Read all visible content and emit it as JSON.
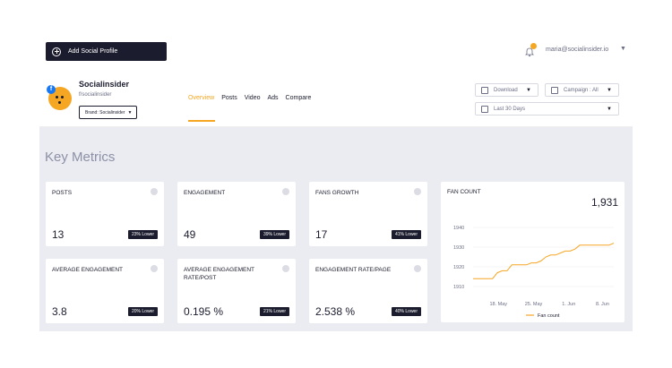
{
  "topbar": {
    "add_profile_label": "Add Social Profile",
    "user_email": "maria@socialinsider.io",
    "user_caret": "▼"
  },
  "profile": {
    "name": "Socialinsider",
    "handle": "f/socialinsider",
    "brand_select": "Brand: Socialinsider",
    "brand_caret": "▼"
  },
  "tabs": [
    "Overview",
    "Posts",
    "Video",
    "Ads",
    "Compare"
  ],
  "controls": {
    "download": "Download",
    "campaign": "Campaign : All",
    "period": "Last 30 Days",
    "caret": "▼"
  },
  "section_title": "Key Metrics",
  "metrics": [
    {
      "label": "POSTS",
      "value": "13",
      "badge": "23% Lower"
    },
    {
      "label": "ENGAGEMENT",
      "value": "49",
      "badge": "39% Lower"
    },
    {
      "label": "FANS GROWTH",
      "value": "17",
      "badge": "41% Lower"
    },
    {
      "label": "AVERAGE ENGAGEMENT",
      "value": "3.8",
      "badge": "20% Lower"
    },
    {
      "label": "AVERAGE ENGAGEMENT RATE/POST",
      "value": "0.195 %",
      "badge": "21% Lower"
    },
    {
      "label": "ENGAGEMENT RATE/PAGE",
      "value": "2.538 %",
      "badge": "40% Lower"
    }
  ],
  "fan_count": {
    "label": "FAN COUNT",
    "value": "1,931"
  },
  "colors": {
    "accent": "#f5a623",
    "dark": "#1b1c2e",
    "background": "#eaecf1"
  },
  "chart_data": {
    "type": "line",
    "x_ticks": [
      "18. May",
      "25. May",
      "1. Jun",
      "8. Jun"
    ],
    "y_ticks": [
      1910,
      1920,
      1930,
      1940
    ],
    "ylim": [
      1905,
      1945
    ],
    "series": [
      {
        "name": "Fan count",
        "x": [
          0,
          1,
          2,
          3,
          4,
          5,
          6,
          7,
          8,
          9,
          10,
          11,
          12,
          13,
          14,
          15,
          16,
          17,
          18,
          19,
          20,
          21,
          22,
          23,
          24,
          25,
          26,
          27,
          28,
          29
        ],
        "values": [
          1914,
          1914,
          1914,
          1914,
          1914,
          1917,
          1918,
          1918,
          1921,
          1921,
          1921,
          1921,
          1922,
          1922,
          1923,
          1925,
          1926,
          1926,
          1927,
          1928,
          1928,
          1929,
          1931,
          1931,
          1931,
          1931,
          1931,
          1931,
          1931,
          1932
        ]
      }
    ]
  }
}
